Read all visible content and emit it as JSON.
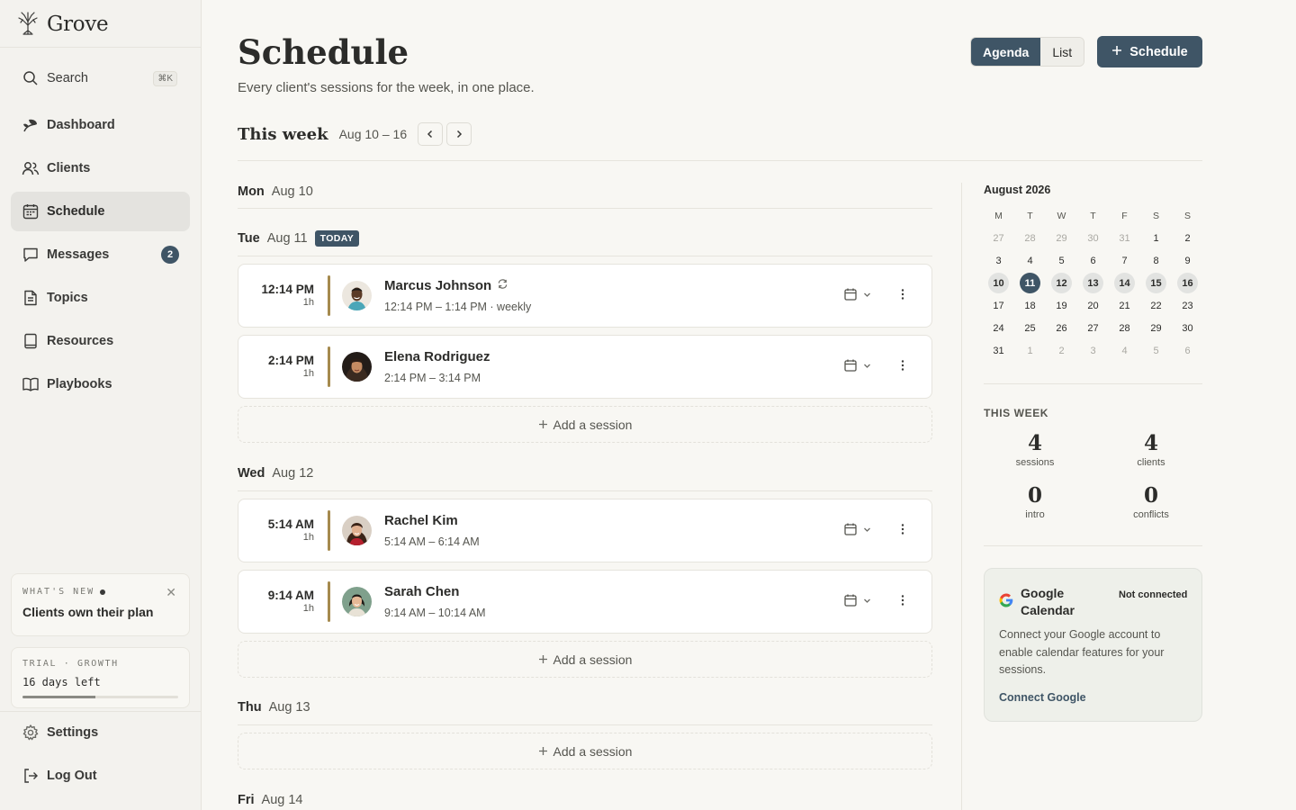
{
  "app": {
    "name": "Grove"
  },
  "sidebar": {
    "search_label": "Search",
    "search_shortcut": "⌘K",
    "items": [
      {
        "label": "Dashboard",
        "icon": "plant-icon"
      },
      {
        "label": "Clients",
        "icon": "users-icon"
      },
      {
        "label": "Schedule",
        "icon": "calendar-icon"
      },
      {
        "label": "Messages",
        "icon": "message-icon",
        "badge": "2"
      },
      {
        "label": "Topics",
        "icon": "document-icon"
      },
      {
        "label": "Resources",
        "icon": "notebook-icon"
      },
      {
        "label": "Playbooks",
        "icon": "book-icon"
      }
    ],
    "whats_new": {
      "eyebrow": "WHAT'S NEW",
      "title": "Clients own their plan"
    },
    "trial": {
      "eyebrow": "TRIAL · GROWTH",
      "days_left": "16 days left",
      "progress": 0.47
    },
    "settings_label": "Settings",
    "logout_label": "Log Out"
  },
  "header": {
    "title": "Schedule",
    "subtitle": "Every client's sessions for the week, in one place.",
    "view_agenda": "Agenda",
    "view_list": "List",
    "schedule_button": "Schedule"
  },
  "week": {
    "title": "This week",
    "range": "Aug 10 – 16"
  },
  "days": {
    "mon": {
      "name": "Mon",
      "date": "Aug 10"
    },
    "tue": {
      "name": "Tue",
      "date": "Aug 11",
      "tag": "TODAY"
    },
    "wed": {
      "name": "Wed",
      "date": "Aug 12"
    },
    "thu": {
      "name": "Thu",
      "date": "Aug 13"
    },
    "fri": {
      "name": "Fri",
      "date": "Aug 14"
    }
  },
  "sessions": [
    {
      "time": "12:14 PM",
      "duration": "1h",
      "name": "Marcus Johnson",
      "detail": "12:14 PM – 1:14 PM · weekly",
      "recurring": true
    },
    {
      "time": "2:14 PM",
      "duration": "1h",
      "name": "Elena Rodriguez",
      "detail": "2:14 PM – 3:14 PM"
    },
    {
      "time": "5:14 AM",
      "duration": "1h",
      "name": "Rachel Kim",
      "detail": "5:14 AM – 6:14 AM"
    },
    {
      "time": "9:14 AM",
      "duration": "1h",
      "name": "Sarah Chen",
      "detail": "9:14 AM – 10:14 AM"
    }
  ],
  "add_session_label": "Add a session",
  "calendar": {
    "month": "August 2026",
    "weekdays": [
      "M",
      "T",
      "W",
      "T",
      "F",
      "S",
      "S"
    ],
    "days": [
      [
        "27",
        "28",
        "29",
        "30",
        "31",
        "1",
        "2"
      ],
      [
        "3",
        "4",
        "5",
        "6",
        "7",
        "8",
        "9"
      ],
      [
        "10",
        "11",
        "12",
        "13",
        "14",
        "15",
        "16"
      ],
      [
        "17",
        "18",
        "19",
        "20",
        "21",
        "22",
        "23"
      ],
      [
        "24",
        "25",
        "26",
        "27",
        "28",
        "29",
        "30"
      ],
      [
        "31",
        "1",
        "2",
        "3",
        "4",
        "5",
        "6"
      ]
    ],
    "today": "11"
  },
  "this_week": {
    "label": "THIS WEEK",
    "stats": [
      {
        "value": "4",
        "label": "sessions"
      },
      {
        "value": "4",
        "label": "clients"
      },
      {
        "value": "0",
        "label": "intro"
      },
      {
        "value": "0",
        "label": "conflicts"
      }
    ]
  },
  "google": {
    "title": "Google Calendar",
    "status": "Not connected",
    "description": "Connect your Google account to enable calendar features for your sessions.",
    "link": "Connect Google"
  },
  "colors": {
    "accent": "#3f5566",
    "session_bar": "#a58a4e",
    "background": "#f8f7f3"
  }
}
